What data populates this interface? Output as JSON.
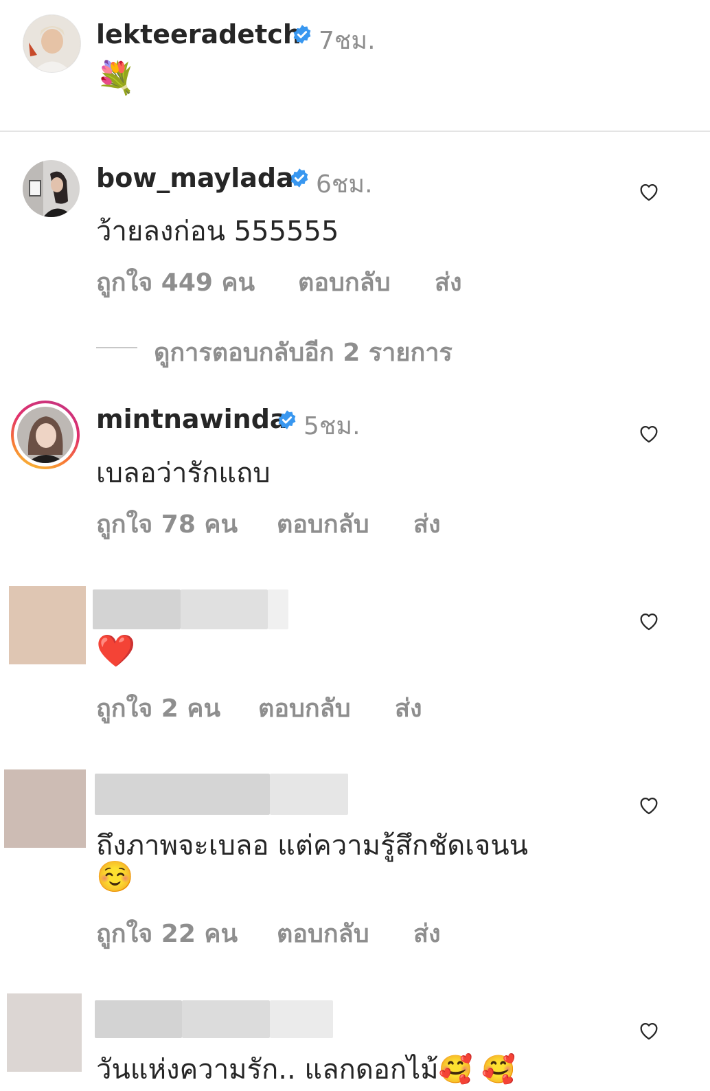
{
  "post": {
    "username": "lekteeradetch",
    "time": "7ชม.",
    "emoji": "💐"
  },
  "comments": [
    {
      "username": "bow_maylada",
      "time": "6ชม.",
      "text": "ว้ายลงก่อน 555555",
      "likes": "ถูกใจ 449 คน",
      "reply": "ตอบกลับ",
      "send": "ส่ง",
      "view_replies": "ดูการตอบกลับอีก 2 รายการ"
    },
    {
      "username": "mintnawinda",
      "time": "5ชม.",
      "text": "เบลอว่ารักแถบ",
      "likes": "ถูกใจ 78 คน",
      "reply": "ตอบกลับ",
      "send": "ส่ง"
    },
    {
      "text": "❤️",
      "likes": "ถูกใจ 2 คน",
      "reply": "ตอบกลับ",
      "send": "ส่ง",
      "avatar_color": "#dfc6b3"
    },
    {
      "text": "ถึงภาพจะเบลอ แต่ความรู้สึกชัดเจนน",
      "text2": "☺️",
      "likes": "ถูกใจ 22 คน",
      "reply": "ตอบกลับ",
      "send": "ส่ง",
      "avatar_color": "#cdbcb4"
    },
    {
      "text": "วันแห่งความรัก.. แลกดอกไม้🥰 🥰",
      "avatar_color": "#dcd6d3"
    }
  ],
  "colors": {
    "verified": "#3897f0",
    "meta_gray": "#8e8e8e",
    "text": "#262626",
    "story_ring_start": "#f9ce34",
    "story_ring_end": "#c13584"
  },
  "icons": [
    "verified-badge-icon",
    "heart-outline-icon"
  ]
}
